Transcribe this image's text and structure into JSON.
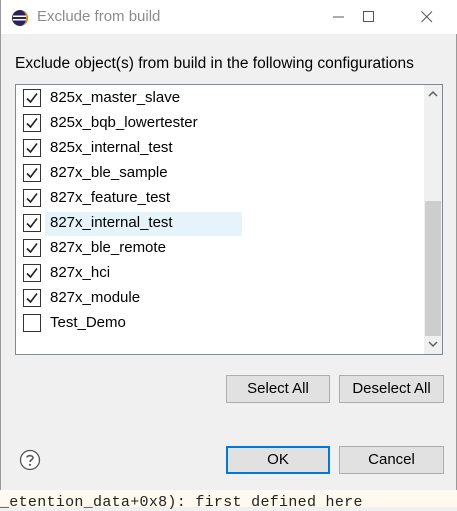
{
  "window": {
    "title": "Exclude from build"
  },
  "prompt": "Exclude object(s) from build in the following configurations",
  "configurations": [
    {
      "label": "825x_master_slave",
      "checked": true
    },
    {
      "label": "825x_bqb_lowertester",
      "checked": true
    },
    {
      "label": "825x_internal_test",
      "checked": true
    },
    {
      "label": "827x_ble_sample",
      "checked": true
    },
    {
      "label": "827x_feature_test",
      "checked": true
    },
    {
      "label": "827x_internal_test",
      "checked": true,
      "highlighted": true
    },
    {
      "label": "827x_ble_remote",
      "checked": true
    },
    {
      "label": "827x_hci",
      "checked": true
    },
    {
      "label": "827x_module",
      "checked": true
    },
    {
      "label": "Test_Demo",
      "checked": false
    }
  ],
  "buttons": {
    "select_all": "Select All",
    "deselect_all": "Deselect All",
    "ok": "OK",
    "cancel": "Cancel"
  },
  "background_text": "_etention_data+0x8): first defined here",
  "colors": {
    "accent": "#0078d7",
    "highlight": "#e5f3fb"
  }
}
